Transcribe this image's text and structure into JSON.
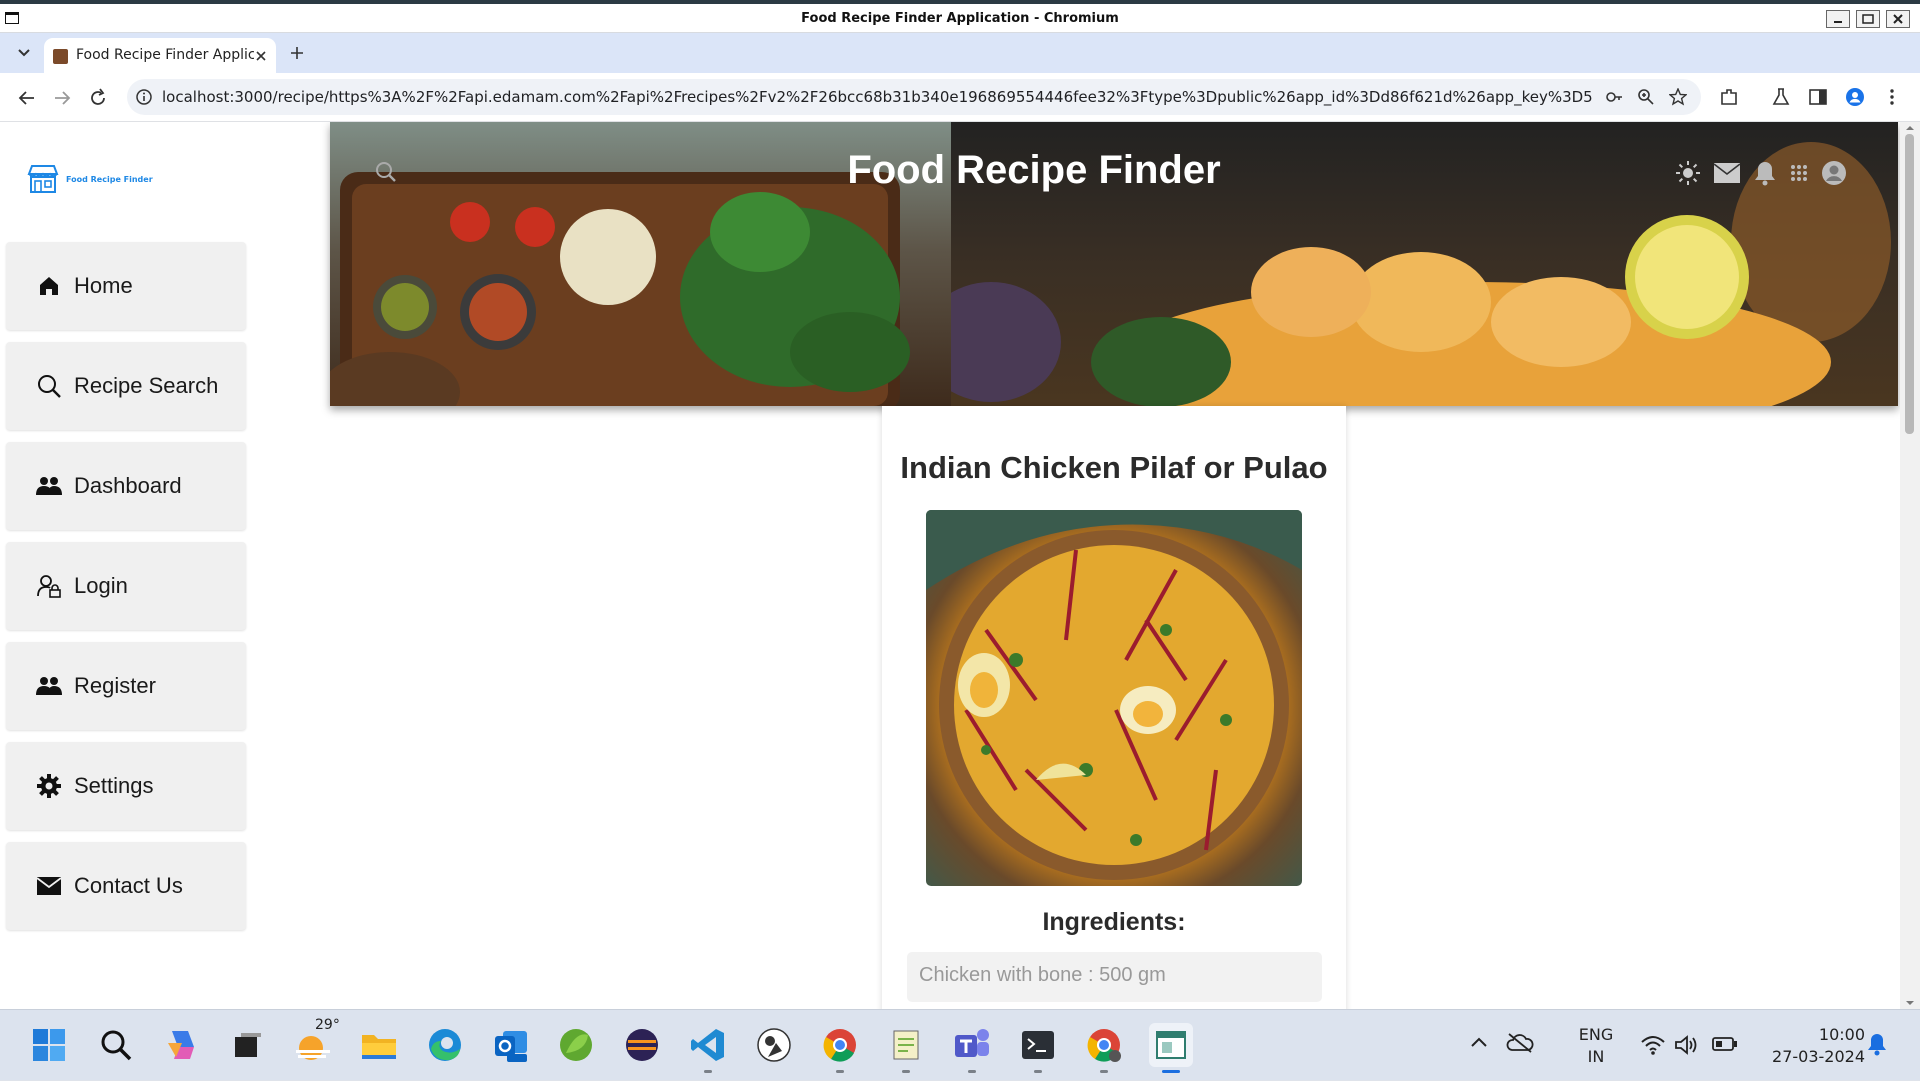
{
  "window": {
    "title": "Food Recipe Finder Application - Chromium"
  },
  "tab": {
    "title": "Food Recipe Finder Applic"
  },
  "address_bar": {
    "url": "localhost:3000/recipe/https%3A%2F%2Fapi.edamam.com%2Fapi%2Frecipes%2Fv2%2F26bcc68b31b340e196869554446fee32%3Ftype%3Dpublic%26app_id%3Dd86f621d%26app_key%3D57021c992..."
  },
  "sidebar": {
    "brand": "Food Recipe Finder",
    "items": [
      {
        "label": "Home",
        "icon": "home-icon"
      },
      {
        "label": "Recipe Search",
        "icon": "search-icon"
      },
      {
        "label": "Dashboard",
        "icon": "people-icon"
      },
      {
        "label": "Login",
        "icon": "user-lock-icon"
      },
      {
        "label": "Register",
        "icon": "people-icon"
      },
      {
        "label": "Settings",
        "icon": "gear-icon"
      },
      {
        "label": "Contact Us",
        "icon": "mail-icon"
      }
    ]
  },
  "header": {
    "title": "Food Recipe Finder",
    "icons": [
      "sun-icon",
      "mail-icon",
      "bell-icon",
      "apps-grid-icon",
      "profile-icon"
    ]
  },
  "recipe": {
    "title": "Indian Chicken Pilaf or Pulao",
    "ingredients_heading": "Ingredients:",
    "ingredients": [
      "Chicken with bone : 500 gm"
    ]
  },
  "taskbar": {
    "weather_temp": "29°",
    "lang_line1": "ENG",
    "lang_line2": "IN",
    "time": "10:00",
    "date": "27-03-2024"
  },
  "colors": {
    "accent": "#1e88e5",
    "sidebar_item_bg": "#f0f0f0",
    "tab_strip": "#dbe5f8"
  }
}
